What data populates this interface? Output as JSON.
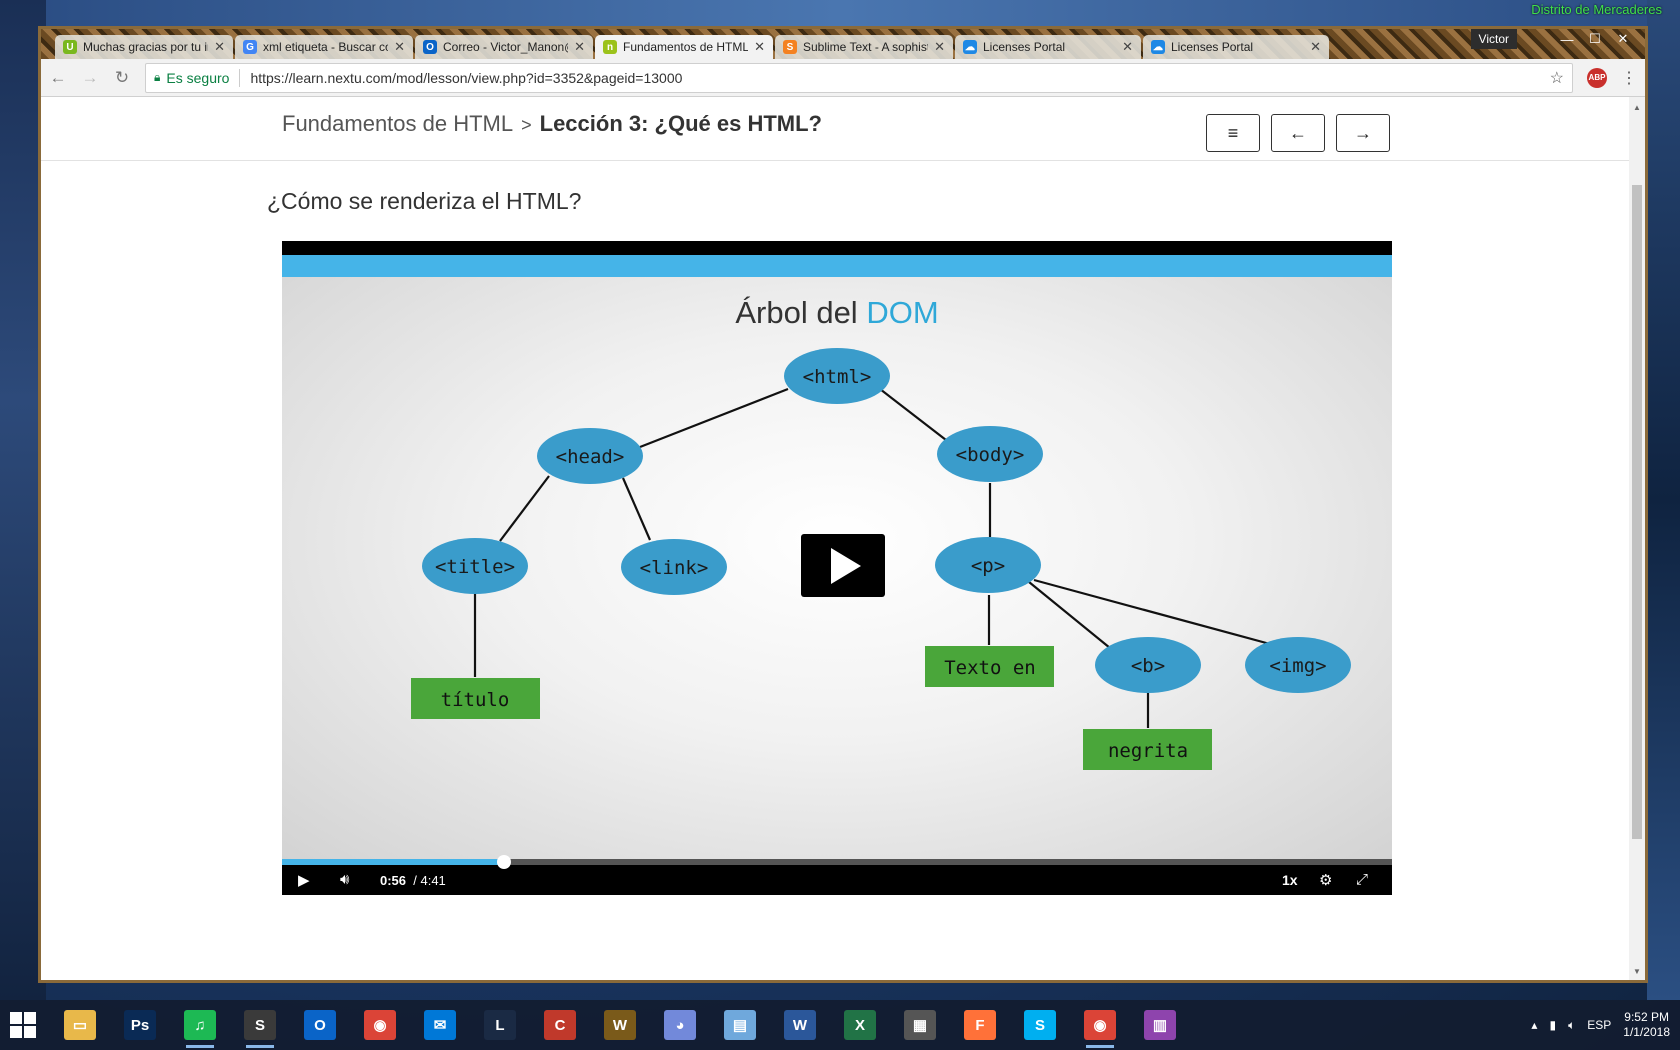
{
  "desktop": {
    "zone_label": "Distrito de Mercaderes"
  },
  "window": {
    "user": "Victor",
    "minimize": "—",
    "maximize": "☐",
    "close": "✕"
  },
  "tabs": [
    {
      "title": "Muchas gracias por tu in",
      "fav": "U",
      "fav_color": "#7ab81e"
    },
    {
      "title": "xml etiqueta - Buscar con",
      "fav": "G",
      "fav_color": "#4285f4"
    },
    {
      "title": "Correo - Victor_Manon@",
      "fav": "O",
      "fav_color": "#0a64c8"
    },
    {
      "title": "Fundamentos de HTML",
      "fav": "n",
      "fav_color": "#9bc21b"
    },
    {
      "title": "Sublime Text - A sophist",
      "fav": "S",
      "fav_color": "#f48120"
    },
    {
      "title": "Licenses Portal",
      "fav": "☁",
      "fav_color": "#1e88e5"
    },
    {
      "title": "Licenses Portal",
      "fav": "☁",
      "fav_color": "#1e88e5"
    }
  ],
  "toolbar": {
    "back": "←",
    "forward": "→",
    "reload": "↻",
    "secure_label": "Es seguro",
    "url": "https://learn.nextu.com/mod/lesson/view.php?id=3352&pageid=13000",
    "star": "☆",
    "abp": "ABP",
    "menu": "⋮"
  },
  "lesson": {
    "course": "Fundamentos de HTML",
    "separator": ">",
    "current": "Lección 3: ¿Qué es HTML?",
    "menu_btn": "≡",
    "prev_btn": "←",
    "next_btn": "→",
    "section_title": "¿Cómo se renderiza el HTML?"
  },
  "slide": {
    "title_part1": "Árbol del ",
    "title_accent": "DOM",
    "nodes": {
      "html": "<html>",
      "head": "<head>",
      "body": "<body>",
      "title": "<title>",
      "link": "<link>",
      "p": "<p>",
      "b": "<b>",
      "img": "<img>"
    },
    "leaves": {
      "titulo": "título",
      "texto": "Texto en",
      "negrita": "negrita"
    },
    "node_color": "#3a9ccb",
    "leaf_color": "#4aa63a"
  },
  "player": {
    "current_time": "0:56",
    "duration": "/ 4:41",
    "speed": "1x",
    "progress_fraction": 0.2
  },
  "taskbar": {
    "apps": [
      {
        "name": "file-explorer",
        "label": "▭",
        "color": "#e8b84a"
      },
      {
        "name": "photoshop",
        "label": "Ps",
        "color": "#0a2a55"
      },
      {
        "name": "spotify",
        "label": "♫",
        "color": "#1db954"
      },
      {
        "name": "sublime",
        "label": "S",
        "color": "#3a3a3a"
      },
      {
        "name": "outlook",
        "label": "O",
        "color": "#0a64c8"
      },
      {
        "name": "chrome",
        "label": "◉",
        "color": "#db4437"
      },
      {
        "name": "mail",
        "label": "✉",
        "color": "#0078d7"
      },
      {
        "name": "league",
        "label": "L",
        "color": "#1a2a44"
      },
      {
        "name": "ccleaner",
        "label": "C",
        "color": "#c0392b"
      },
      {
        "name": "wow",
        "label": "W",
        "color": "#7a5a1a"
      },
      {
        "name": "discord",
        "label": "◕",
        "color": "#7289da"
      },
      {
        "name": "notepad",
        "label": "▤",
        "color": "#6fa8dc"
      },
      {
        "name": "word",
        "label": "W",
        "color": "#2b579a"
      },
      {
        "name": "excel",
        "label": "X",
        "color": "#217346"
      },
      {
        "name": "calculator",
        "label": "▦",
        "color": "#555"
      },
      {
        "name": "firefox-dev",
        "label": "F",
        "color": "#ff7139"
      },
      {
        "name": "skype",
        "label": "S",
        "color": "#00aff0"
      },
      {
        "name": "chrome-2",
        "label": "◉",
        "color": "#db4437"
      },
      {
        "name": "winrar",
        "label": "▥",
        "color": "#8e44ad"
      }
    ],
    "lang": "ESP",
    "time": "9:52 PM",
    "date": "1/1/2018"
  }
}
